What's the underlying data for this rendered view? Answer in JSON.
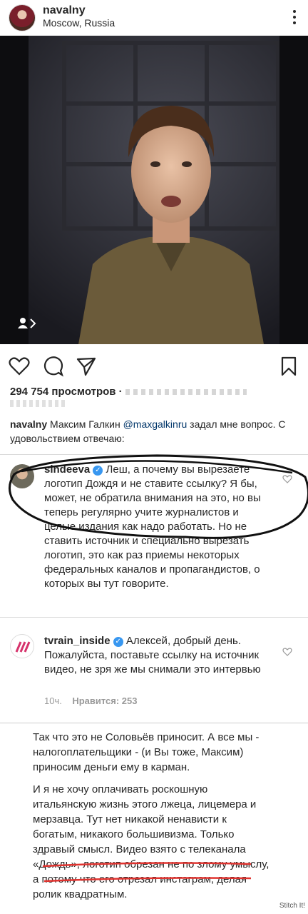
{
  "post": {
    "username": "navalny",
    "location": "Moscow, Russia"
  },
  "views_text": "294 754 просмотров · ",
  "caption": {
    "username": "navalny",
    "text_before": " Максим Галкин ",
    "mention": "@maxgalkinru",
    "text_after": " задал мне вопрос. С удовольствием отвечаю:"
  },
  "comments": [
    {
      "username": "sindeeva",
      "text": " Леш, а почему вы вырезаете логотип Дождя и не ставите ссылку? Я бы, может, не обратила внимания на это, но вы теперь регулярно учите журналистов и целые издания как надо работать. Но не ставить источник и специально вырезать логотип, это  как раз приемы некоторых федеральных каналов и пропагандистов, о которых вы тут говорите."
    },
    {
      "username": "tvrain_inside",
      "text": " Алексей, добрый день. Пожалуйста, поставьте ссылку на источник видео, не зря же мы снимали это интервью",
      "time": "10ч.",
      "likes": "Нравится: 253"
    }
  ],
  "note": {
    "p1": "Так что это не Соловьёв приносит. А все мы - налогоплательщики - (и Вы тоже, Максим) приносим деньги ему в карман.",
    "p2": "И я не хочу оплачивать роскошную итальянскую жизнь этого лжеца, лицемера и мерзавца. Тут нет никакой ненависти к богатым, никакого большивизма. Только здравый смысл. Видео взято с телеканала «Дождь», логотип обрезан не по злому умыслу, а потому что его отрезал инстаграм, делая ролик квадратным."
  },
  "watermark": "Stitch It!",
  "colors": {
    "verified": "#3897f0",
    "annotation_ink": "#111111",
    "underline": "#e0332f",
    "tvrain_logo": "#d6336c"
  },
  "icons": [
    "more-icon",
    "heart-icon",
    "comment-icon",
    "share-icon",
    "bookmark-icon",
    "video-badge-icon",
    "verified-icon"
  ]
}
